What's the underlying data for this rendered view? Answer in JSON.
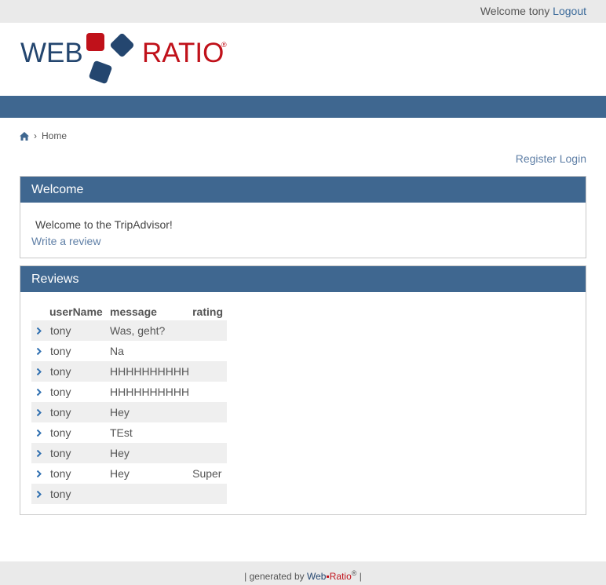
{
  "topbar": {
    "welcome": "Welcome tony",
    "logout": "Logout"
  },
  "logo": {
    "left": "WEB",
    "right": "RATIO",
    "reg": "®",
    "colors": {
      "navy": "#24466f",
      "red": "#c0111a"
    }
  },
  "breadcrumb": {
    "home_icon": "home-icon",
    "separator": "›",
    "label": "Home"
  },
  "auth_links": {
    "register": "Register",
    "login": "Login"
  },
  "welcome_panel": {
    "title": "Welcome",
    "text": "Welcome to the TripAdvisor!",
    "link": "Write a review"
  },
  "reviews_panel": {
    "title": "Reviews",
    "columns": [
      "userName",
      "message",
      "rating"
    ],
    "rows": [
      {
        "user": "tony",
        "message": "Was, geht?",
        "rating": ""
      },
      {
        "user": "tony",
        "message": "Na",
        "rating": ""
      },
      {
        "user": "tony",
        "message": "HHHHHHHHHH",
        "rating": ""
      },
      {
        "user": "tony",
        "message": "HHHHHHHHHH",
        "rating": ""
      },
      {
        "user": "tony",
        "message": "Hey",
        "rating": ""
      },
      {
        "user": "tony",
        "message": "TEst",
        "rating": ""
      },
      {
        "user": "tony",
        "message": "Hey",
        "rating": ""
      },
      {
        "user": "tony",
        "message": "Hey",
        "rating": "Super"
      },
      {
        "user": "tony",
        "message": "",
        "rating": ""
      }
    ]
  },
  "footer": {
    "prefix": "| generated by ",
    "brand_left": "Web",
    "brand_right": "Ratio",
    "reg": "®",
    "suffix": " |"
  },
  "colors": {
    "header_blue": "#3f6790",
    "link": "#5f7fa6",
    "row_alt": "#efefef"
  }
}
